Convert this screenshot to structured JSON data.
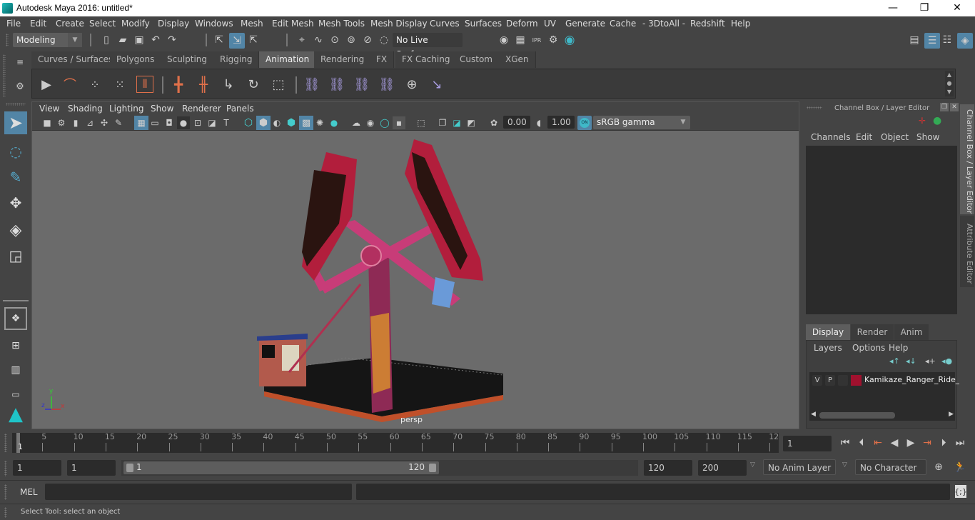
{
  "window": {
    "title": "Autodesk Maya 2016: untitled*",
    "minimize_glyph": "—",
    "restore_glyph": "❐",
    "close_glyph": "✕"
  },
  "menubar": [
    "File",
    "Edit",
    "Create",
    "Select",
    "Modify",
    "Display",
    "Windows",
    "Mesh",
    "Edit Mesh",
    "Mesh Tools",
    "Mesh Display",
    "Curves",
    "Surfaces",
    "Deform",
    "UV",
    "Generate",
    "Cache",
    "- 3DtoAll -",
    "Redshift",
    "Help"
  ],
  "toolbar": {
    "mode": "Modeling",
    "live_surface": "No Live Surface",
    "render_icons": [
      "render-view-icon",
      "render-frame-icon",
      "ipr-render-icon",
      "render-settings-icon",
      "hypershade-icon"
    ],
    "right_icons": [
      "modeling-toolkit-icon",
      "attribute-editor-icon",
      "tool-settings-icon",
      "channel-box-icon"
    ]
  },
  "shelf": {
    "tabs": [
      "Curves / Surfaces",
      "Polygons",
      "Sculpting",
      "Rigging",
      "Animation",
      "Rendering",
      "FX",
      "FX Caching",
      "Custom",
      "XGen"
    ],
    "active_tab": "Animation",
    "icons": [
      "playblast-icon",
      "graph-editor-icon",
      "set-key-icon",
      "ghost-icon",
      "timeline-bookmark-icon",
      "key-icon",
      "breakdown-key-icon",
      "key-translate-icon",
      "key-rotate-icon",
      "key-scale-icon",
      "parent-constraint-icon",
      "point-constraint-icon",
      "orient-constraint-icon",
      "scale-constraint-icon",
      "aim-constraint-icon",
      "pole-vector-icon"
    ]
  },
  "toolbox": [
    "select-tool",
    "lasso-tool",
    "paint-select-tool",
    "move-tool",
    "rotate-tool",
    "scale-tool"
  ],
  "viewport": {
    "menu": [
      "View",
      "Shading",
      "Lighting",
      "Show",
      "Renderer",
      "Panels"
    ],
    "exposure": "0.00",
    "gamma": "1.00",
    "color_mgmt": "ON",
    "color_space": "sRGB gamma",
    "camera_label": "persp",
    "axis": {
      "x": "x",
      "y": "y",
      "z": "z"
    }
  },
  "channel_box": {
    "title": "Channel Box / Layer Editor",
    "menu": [
      "Channels",
      "Edit",
      "Object",
      "Show"
    ]
  },
  "layer_editor": {
    "tabs": [
      "Display",
      "Render",
      "Anim"
    ],
    "active_tab": "Display",
    "menu": [
      "Layers",
      "Options",
      "Help"
    ],
    "layers": [
      {
        "v": "V",
        "p": "P",
        "color": "#a0112e",
        "name": "Kamikaze_Ranger_Ride_A"
      }
    ]
  },
  "side_tabs": [
    "Channel Box / Layer Editor",
    "Attribute Editor"
  ],
  "timeline": {
    "ticks": [
      "5",
      "10",
      "15",
      "20",
      "25",
      "30",
      "35",
      "40",
      "45",
      "50",
      "55",
      "60",
      "65",
      "70",
      "75",
      "80",
      "85",
      "90",
      "95",
      "100",
      "105",
      "110",
      "115",
      "12"
    ],
    "current_frame_marker": "1",
    "current_frame": "1"
  },
  "range": {
    "start": "1",
    "anim_start": "1",
    "slider_start": "1",
    "slider_end": "120",
    "end": "120",
    "anim_end": "200",
    "anim_layer": "No Anim Layer",
    "character_set": "No Character Set"
  },
  "mel": {
    "label": "MEL"
  },
  "status": "Select Tool: select an object"
}
